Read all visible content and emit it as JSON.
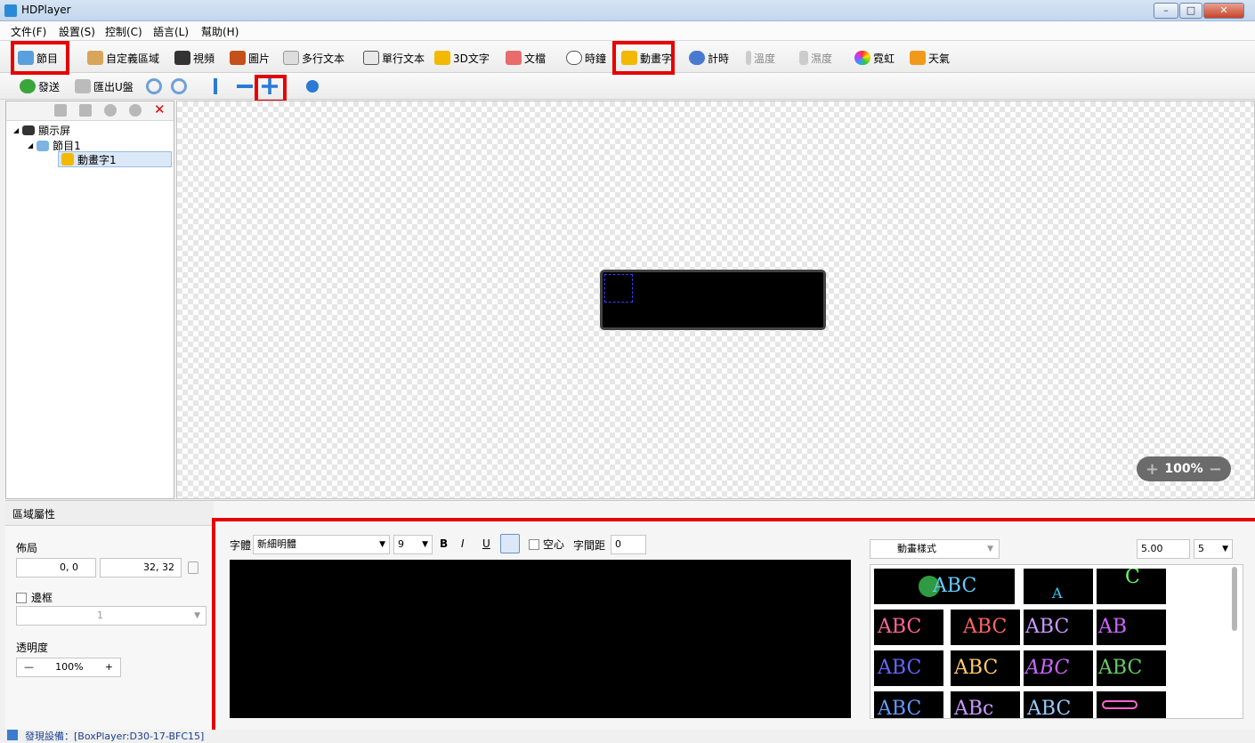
{
  "window": {
    "title": "HDPlayer"
  },
  "menu": [
    "文件(F)",
    "設置(S)",
    "控制(C)",
    "語言(L)",
    "幫助(H)"
  ],
  "toolbar1": {
    "program": "節目",
    "custom_area": "自定義區域",
    "video": "視頻",
    "image": "圖片",
    "multiline_text": "多行文本",
    "single_line_text": "單行文本",
    "text3d": "3D文字",
    "doc": "文檔",
    "clock": "時鐘",
    "animated_text": "動畫字",
    "timer": "計時",
    "temperature": "溫度",
    "humidity": "濕度",
    "neon": "霓虹",
    "weather": "天氣"
  },
  "toolbar2": {
    "send": "發送",
    "export_usb": "匯出U盤"
  },
  "tree": {
    "root": "顯示屏",
    "program": "節目1",
    "item": "動畫字1"
  },
  "zoom": {
    "plus": "+",
    "value": "100%",
    "minus": "−"
  },
  "props": {
    "header": "區域屬性",
    "layout_label": "佈局",
    "pos_value": "0, 0",
    "size_value": "32, 32",
    "border_label": "邊框",
    "border_value": "1",
    "opacity_label": "透明度",
    "opacity_value": "100%",
    "minus": "—",
    "plus": "+"
  },
  "editor": {
    "font_label": "字體",
    "font_value": "新細明體",
    "size_value": "9",
    "bold": "B",
    "italic": "I",
    "underline": "U",
    "hollow_label": "空心",
    "spacing_label": "字間距",
    "spacing_value": "0"
  },
  "anim": {
    "style_label": "動畫樣式",
    "speed_value": "5.00",
    "step_value": "5"
  },
  "thumbs": [
    [
      "ABC",
      "A",
      "C"
    ],
    [
      "ABC",
      "ABC",
      "ABC",
      "AB"
    ],
    [
      "ABC",
      "ABC",
      "ABC",
      "ABC"
    ],
    [
      "ABC",
      "ABc",
      "ABC",
      ""
    ]
  ],
  "status": {
    "text": "發現設備：[BoxPlayer:D30-17-BFC15]"
  }
}
